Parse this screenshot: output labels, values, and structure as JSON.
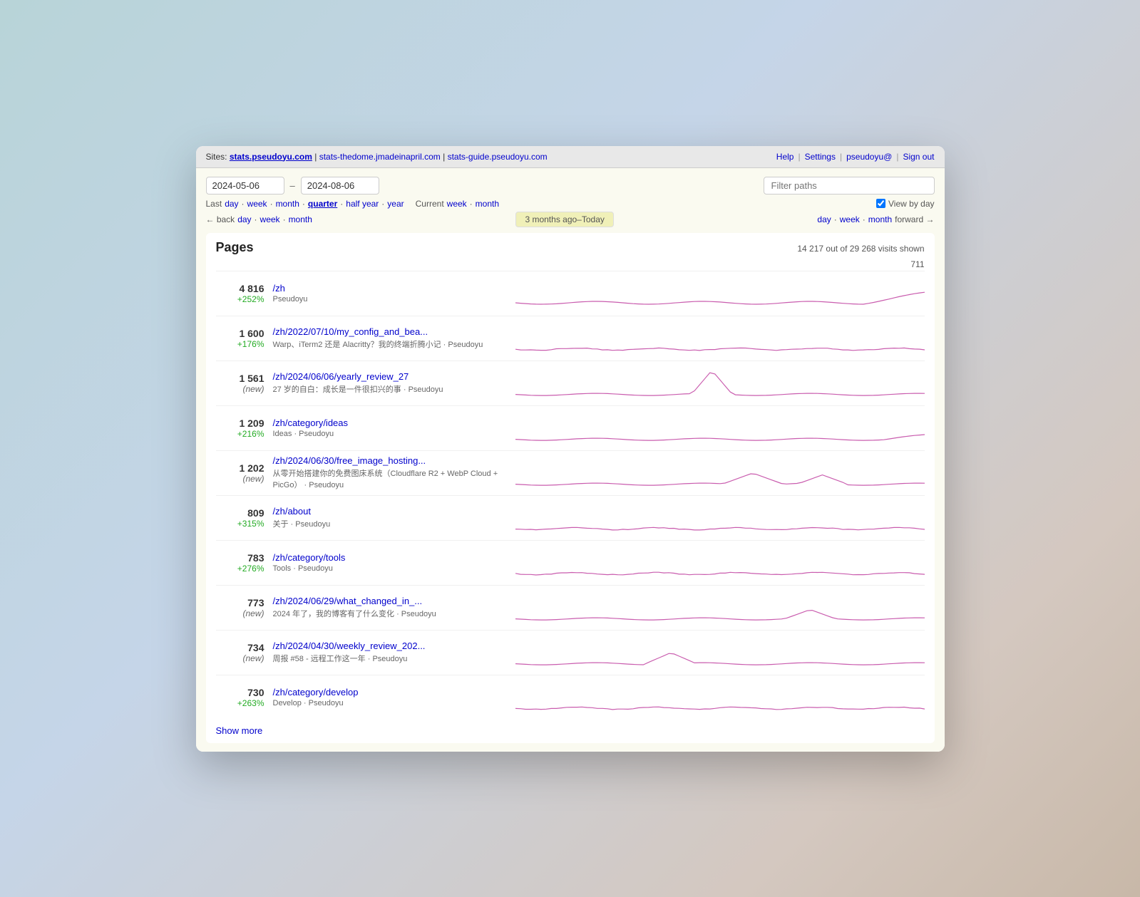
{
  "browser": {
    "sites_label": "Sites:",
    "sites": [
      {
        "label": "stats.pseudoyu.com",
        "url": "#",
        "active": true
      },
      {
        "label": "stats-thedome.jmadeinapril.com",
        "url": "#",
        "active": false
      },
      {
        "label": "stats-guide.pseudoyu.com",
        "url": "#",
        "active": false
      }
    ],
    "right_nav": [
      {
        "label": "Help",
        "url": "#"
      },
      {
        "label": "Settings",
        "url": "#"
      },
      {
        "label": "pseudoyu@",
        "url": "#"
      },
      {
        "label": "Sign out",
        "url": "#"
      }
    ]
  },
  "date_filter": {
    "from": "2024-05-06",
    "to": "2024-08-06",
    "filter_placeholder": "Filter paths"
  },
  "quick_links": {
    "label": "Last",
    "links": [
      "day",
      "week",
      "month",
      "quarter",
      "half year",
      "year"
    ],
    "active": "quarter",
    "current_label": "Current",
    "current_links": [
      "week",
      "month"
    ]
  },
  "view_by_day": {
    "label": "View by day",
    "checked": true
  },
  "nav": {
    "back_label": "← back",
    "back_links": [
      "day",
      "week",
      "month"
    ],
    "period_label": "3 months ago–Today",
    "forward_links": [
      "day",
      "week",
      "month"
    ],
    "forward_label": "forward →"
  },
  "pages": {
    "title": "Pages",
    "summary": "14 217 out of 29 268 visits shown",
    "max_value": "711",
    "show_more": "Show more",
    "items": [
      {
        "visits": "4 816",
        "change": "+252%",
        "change_type": "positive",
        "path": "/zh",
        "subtitle": "Pseudoyu",
        "sparkline_type": "flat_with_rise_end"
      },
      {
        "visits": "1 600",
        "change": "+176%",
        "change_type": "positive",
        "path": "/zh/2022/07/10/my_config_and_bea...",
        "subtitle": "Warp、iTerm2 还是 Alacritty？我的终端折腾小记 · Pseudoyu",
        "sparkline_type": "flat"
      },
      {
        "visits": "1 561",
        "change": "(new)",
        "change_type": "new",
        "path": "/zh/2024/06/06/yearly_review_27",
        "subtitle": "27 岁的自白：成长是一件很扣兴的事 · Pseudoyu",
        "sparkline_type": "spike_middle"
      },
      {
        "visits": "1 209",
        "change": "+216%",
        "change_type": "positive",
        "path": "/zh/category/ideas",
        "subtitle": "Ideas · Pseudoyu",
        "sparkline_type": "flat_with_end"
      },
      {
        "visits": "1 202",
        "change": "(new)",
        "change_type": "new",
        "path": "/zh/2024/06/30/free_image_hosting...",
        "subtitle": "从零开始搭建你的免费图床系统（Cloudflare R2 + WebP Cloud + PicGo） · Pseudoyu",
        "sparkline_type": "double_bumps"
      },
      {
        "visits": "809",
        "change": "+315%",
        "change_type": "positive",
        "path": "/zh/about",
        "subtitle": "关于 · Pseudoyu",
        "sparkline_type": "flat"
      },
      {
        "visits": "783",
        "change": "+276%",
        "change_type": "positive",
        "path": "/zh/category/tools",
        "subtitle": "Tools · Pseudoyu",
        "sparkline_type": "flat"
      },
      {
        "visits": "773",
        "change": "(new)",
        "change_type": "new",
        "path": "/zh/2024/06/29/what_changed_in_...",
        "subtitle": "2024 年了，我的博客有了什么变化 · Pseudoyu",
        "sparkline_type": "small_bump_right"
      },
      {
        "visits": "734",
        "change": "(new)",
        "change_type": "new",
        "path": "/zh/2024/04/30/weekly_review_202...",
        "subtitle": "周报 #58 - 远程工作这一年 · Pseudoyu",
        "sparkline_type": "small_bump_middle"
      },
      {
        "visits": "730",
        "change": "+263%",
        "change_type": "positive",
        "path": "/zh/category/develop",
        "subtitle": "Develop · Pseudoyu",
        "sparkline_type": "flat"
      }
    ]
  }
}
